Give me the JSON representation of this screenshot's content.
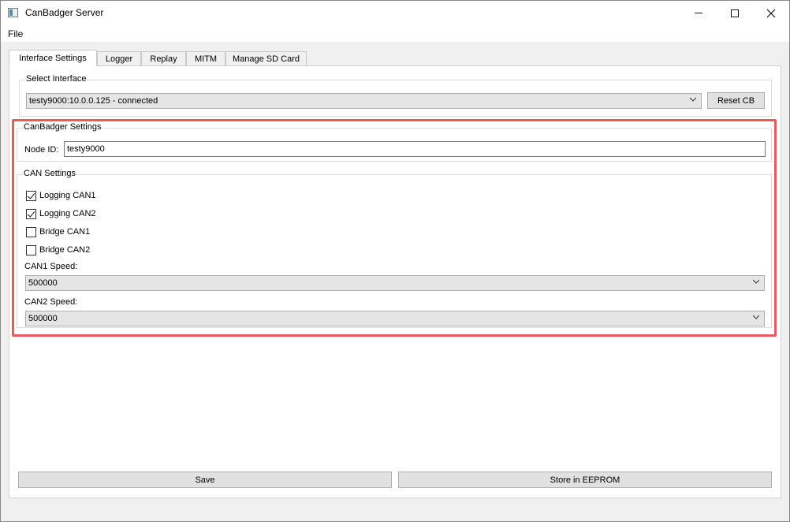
{
  "window": {
    "title": "CanBadger Server"
  },
  "menu": {
    "file": "File"
  },
  "tabs": [
    {
      "label": "Interface Settings"
    },
    {
      "label": "Logger"
    },
    {
      "label": "Replay"
    },
    {
      "label": "MITM"
    },
    {
      "label": "Manage SD Card"
    }
  ],
  "select_interface": {
    "title": "Select Interface",
    "value": "testy9000:10.0.0.125  - connected",
    "reset_label": "Reset CB"
  },
  "canbadger_settings": {
    "title": "CanBadger Settings",
    "node_id_label": "Node ID:",
    "node_id_value": "testy9000"
  },
  "can_settings": {
    "title": "CAN Settings",
    "checkboxes": [
      {
        "label": "Logging CAN1",
        "checked": true
      },
      {
        "label": "Logging CAN2",
        "checked": true
      },
      {
        "label": "Bridge CAN1",
        "checked": false
      },
      {
        "label": "Bridge CAN2",
        "checked": false
      }
    ],
    "can1_speed_label": "CAN1 Speed:",
    "can1_speed_value": "500000",
    "can2_speed_label": "CAN2 Speed:",
    "can2_speed_value": "500000"
  },
  "footer": {
    "save_label": "Save",
    "eeprom_label": "Store in EEPROM"
  },
  "colors": {
    "highlight": "#e85a5f"
  }
}
